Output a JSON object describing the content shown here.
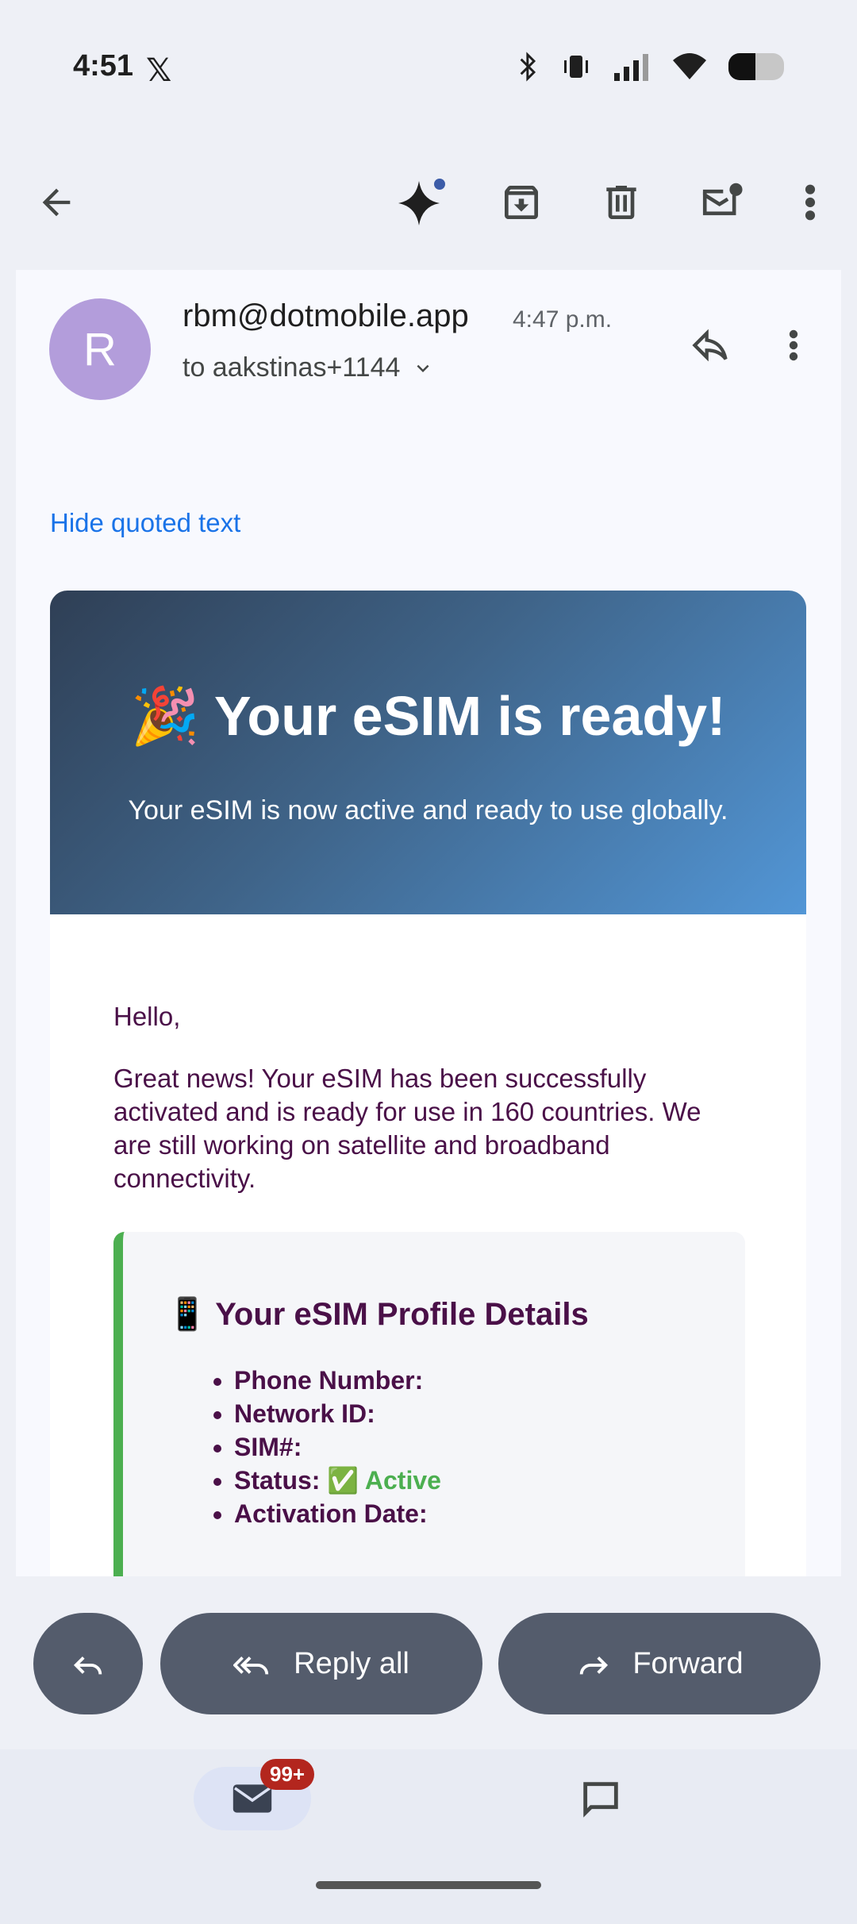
{
  "status": {
    "time": "4:51",
    "app_icon": "x-logo-icon"
  },
  "toolbar": {
    "icons": [
      "back-arrow-icon",
      "gemini-sparkle-icon",
      "archive-icon",
      "delete-icon",
      "mark-unread-icon",
      "more-vert-icon"
    ]
  },
  "email": {
    "avatar_letter": "R",
    "sender": "rbm@dotmobile.app",
    "time": "4:47 p.m.",
    "recipient": "to aakstinas+1144",
    "hide_quoted": "Hide quoted text",
    "hero_title": "🎉 Your eSIM is ready!",
    "hero_subtitle": "Your eSIM is now active and ready to use globally.",
    "greeting": "Hello,",
    "body": "Great news! Your eSIM has been successfully activated and is ready for use in 160 countries. We are still working on satellite and broadband connectivity.",
    "details_title": "📱 Your eSIM Profile Details",
    "details": {
      "phone": "Phone Number:",
      "network": "Network ID:",
      "sim": "SIM#:",
      "status_label": "Status:",
      "status_value": "✅ Active",
      "activation": "Activation Date:"
    }
  },
  "actions": {
    "reply_all": "Reply all",
    "forward": "Forward"
  },
  "nav": {
    "badge": "99+"
  },
  "colors": {
    "accent": "#1a73e8",
    "hero_start": "#2f3f55",
    "hero_end": "#5296d6",
    "active_green": "#4caf50",
    "text_purple": "#4a1048"
  }
}
